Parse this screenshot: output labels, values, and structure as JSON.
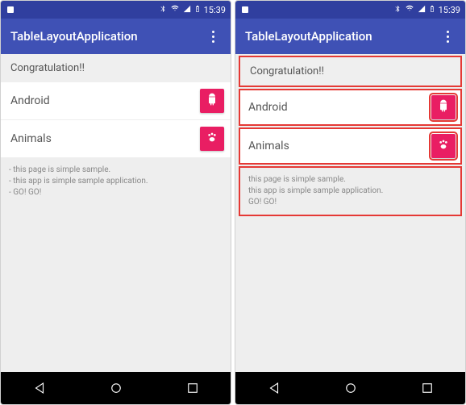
{
  "statusbar": {
    "time": "15:39"
  },
  "appbar": {
    "title": "TableLayoutApplication"
  },
  "rows": {
    "header": "Congratulation!!",
    "item1": {
      "label": "Android"
    },
    "item2": {
      "label": "Animals"
    }
  },
  "footer": {
    "l1": "this page is simple sample.",
    "l2": "this app is simple sample application.",
    "l3": "GO! GO!"
  }
}
